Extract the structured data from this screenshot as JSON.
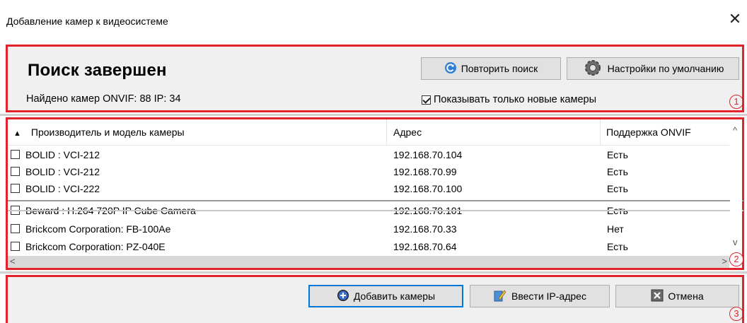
{
  "window": {
    "title": "Добавление камер к видеосистеме",
    "close_glyph": "✕"
  },
  "search": {
    "status_title": "Поиск завершен",
    "found_text": "Найдено камер ONVIF: 88 IP: 34",
    "repeat_button": "Повторить поиск",
    "defaults_button": "Настройки по умолчанию",
    "only_new_label": "Показывать только новые камеры",
    "only_new_checked": true,
    "badge": "1"
  },
  "grid": {
    "columns": [
      "Производитель и модель камеры",
      "Адрес",
      "Поддержка ONVIF"
    ],
    "sort_indicator": "▲",
    "rows": [
      {
        "model": "BOLID : VCI-212",
        "address": "192.168.70.104",
        "onvif": "Есть"
      },
      {
        "model": "BOLID : VCI-212",
        "address": "192.168.70.99",
        "onvif": "Есть"
      },
      {
        "model": "BOLID : VCI-222",
        "address": "192.168.70.100",
        "onvif": "Есть"
      },
      {
        "model": "Beward : H.264 720P IP Cube Camera",
        "address": "192.168.70.101",
        "onvif": "Есть"
      },
      {
        "model": "Brickcom Corporation: FB-100Ae",
        "address": "192.168.70.33",
        "onvif": "Нет"
      },
      {
        "model": "Brickcom Corporation: PZ-040E",
        "address": "192.168.70.64",
        "onvif": "Есть"
      }
    ],
    "badge": "2"
  },
  "footer": {
    "add_button": "Добавить камеры",
    "enter_ip_button": "Ввести IP-адрес",
    "cancel_button": "Отмена",
    "badge": "3"
  },
  "colors": {
    "highlight_border": "#e3232c",
    "dialog_bg": "#f0f0f0",
    "primary_border": "#0078d7"
  }
}
